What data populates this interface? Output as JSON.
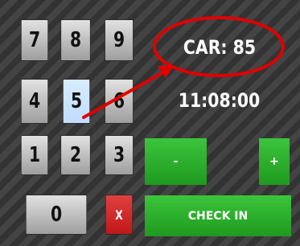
{
  "keypad": {
    "keys": [
      "7",
      "8",
      "9",
      "4",
      "5",
      "6",
      "1",
      "2",
      "3",
      "0"
    ],
    "clear_label": "X"
  },
  "display": {
    "car_text": "CAR: 85",
    "time_text": "11:08:00"
  },
  "controls": {
    "minus_label": "-",
    "plus_label": "+",
    "checkin_label": "CHECK IN"
  },
  "colors": {
    "highlight_red": "#e00000",
    "action_green": "#2eb02e",
    "selected_key": "#cfe5ff"
  }
}
